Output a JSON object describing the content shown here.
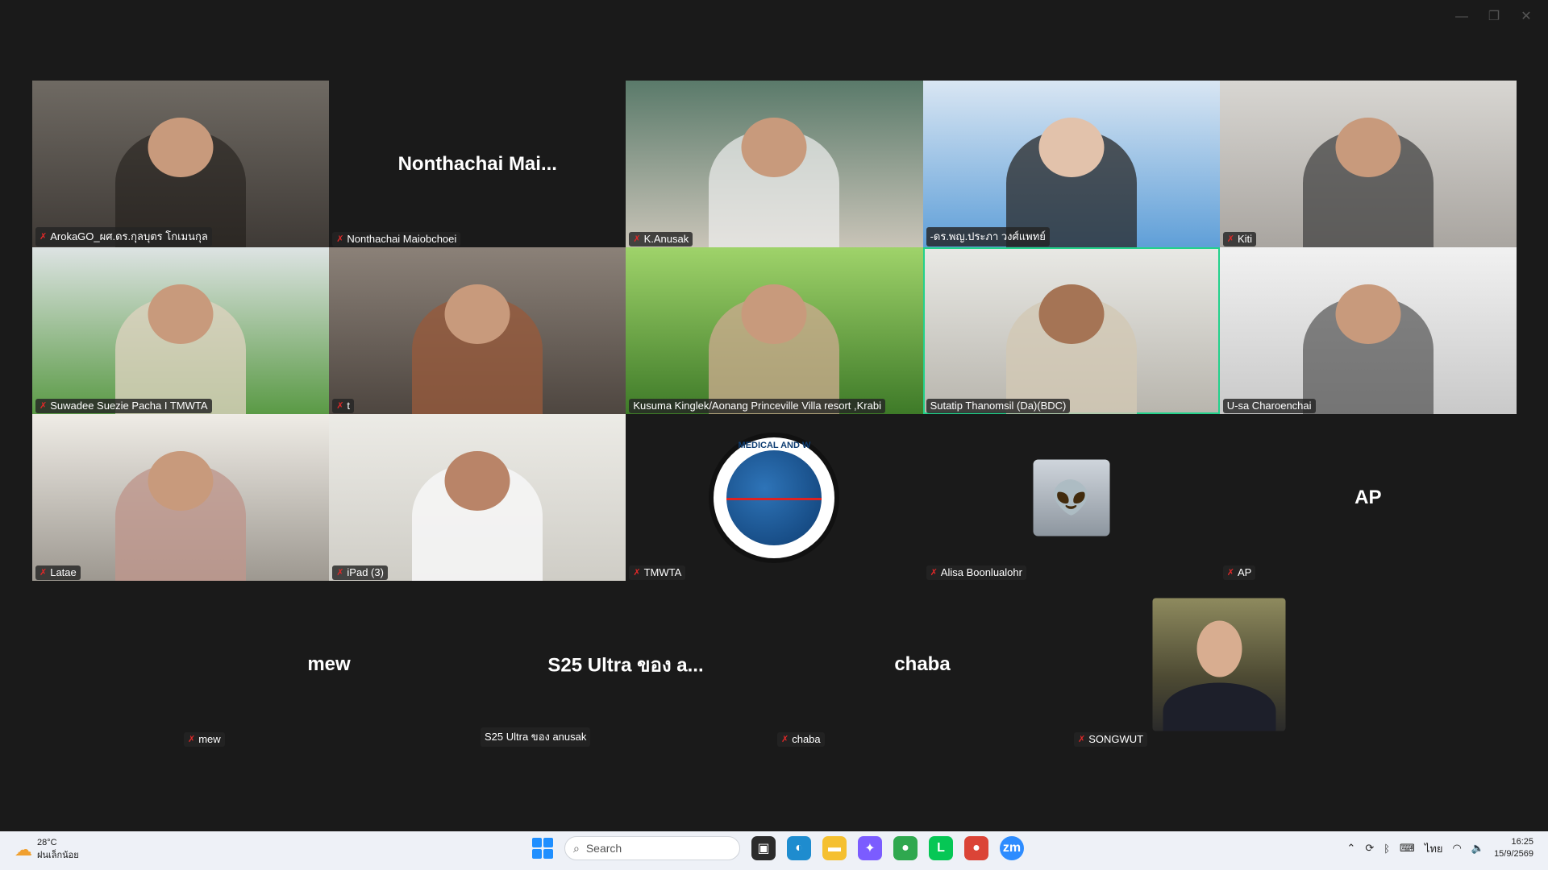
{
  "window_controls": {
    "minimize": "—",
    "maximize": "❐",
    "close": "✕"
  },
  "tiles": [
    {
      "name": "ArokaGO_ผศ.ดร.กุลบุตร โกเมนกุล",
      "muted": true,
      "type": "video"
    },
    {
      "name": "Nonthachai Maiobchoei",
      "display": "Nonthachai  Mai...",
      "muted": true,
      "type": "name"
    },
    {
      "name": "K.Anusak",
      "muted": true,
      "type": "video"
    },
    {
      "name": "-ดร.พญ.ประภา วงศ์แพทย์",
      "muted": false,
      "type": "video"
    },
    {
      "name": "Kiti",
      "muted": true,
      "type": "video"
    },
    {
      "name": "Suwadee Suezie Pacha I TMWTA",
      "muted": true,
      "type": "video"
    },
    {
      "name": "t",
      "muted": true,
      "type": "video"
    },
    {
      "name": "Kusuma Kinglek/Aonang Princeville Villa resort ,Krabi",
      "muted": false,
      "type": "video"
    },
    {
      "name": "Sutatip Thanomsil (Da)(BDC)",
      "muted": false,
      "type": "video",
      "active": true
    },
    {
      "name": "U-sa Charoenchai",
      "muted": false,
      "type": "video"
    },
    {
      "name": "Latae",
      "muted": true,
      "type": "video"
    },
    {
      "name": "iPad (3)",
      "muted": true,
      "type": "video"
    },
    {
      "name": "TMWTA",
      "muted": true,
      "type": "logo",
      "logo_text": "MEDICAL AND W"
    },
    {
      "name": "Alisa Boonlualohr",
      "muted": true,
      "type": "avatar"
    },
    {
      "name": "AP",
      "display": "AP",
      "muted": true,
      "type": "name"
    }
  ],
  "bottom_row": [
    {
      "name": "mew",
      "display": "mew",
      "muted": true,
      "type": "name"
    },
    {
      "name": "S25 Ultra ของ anusak",
      "display": "S25  Ultra ของ a...",
      "muted": false,
      "type": "name"
    },
    {
      "name": "chaba",
      "display": "chaba",
      "muted": true,
      "type": "name"
    },
    {
      "name": "SONGWUT",
      "muted": true,
      "type": "photo"
    }
  ],
  "taskbar": {
    "temp": "28°C",
    "weather_desc": "ฝนเล็กน้อย",
    "search_placeholder": "Search",
    "lang": "ไทย",
    "time": "16:25",
    "date": "15/9/2569"
  },
  "colors": {
    "active_border": "#23d18b",
    "muted_icon": "#e02828",
    "background": "#1a1a1a"
  }
}
